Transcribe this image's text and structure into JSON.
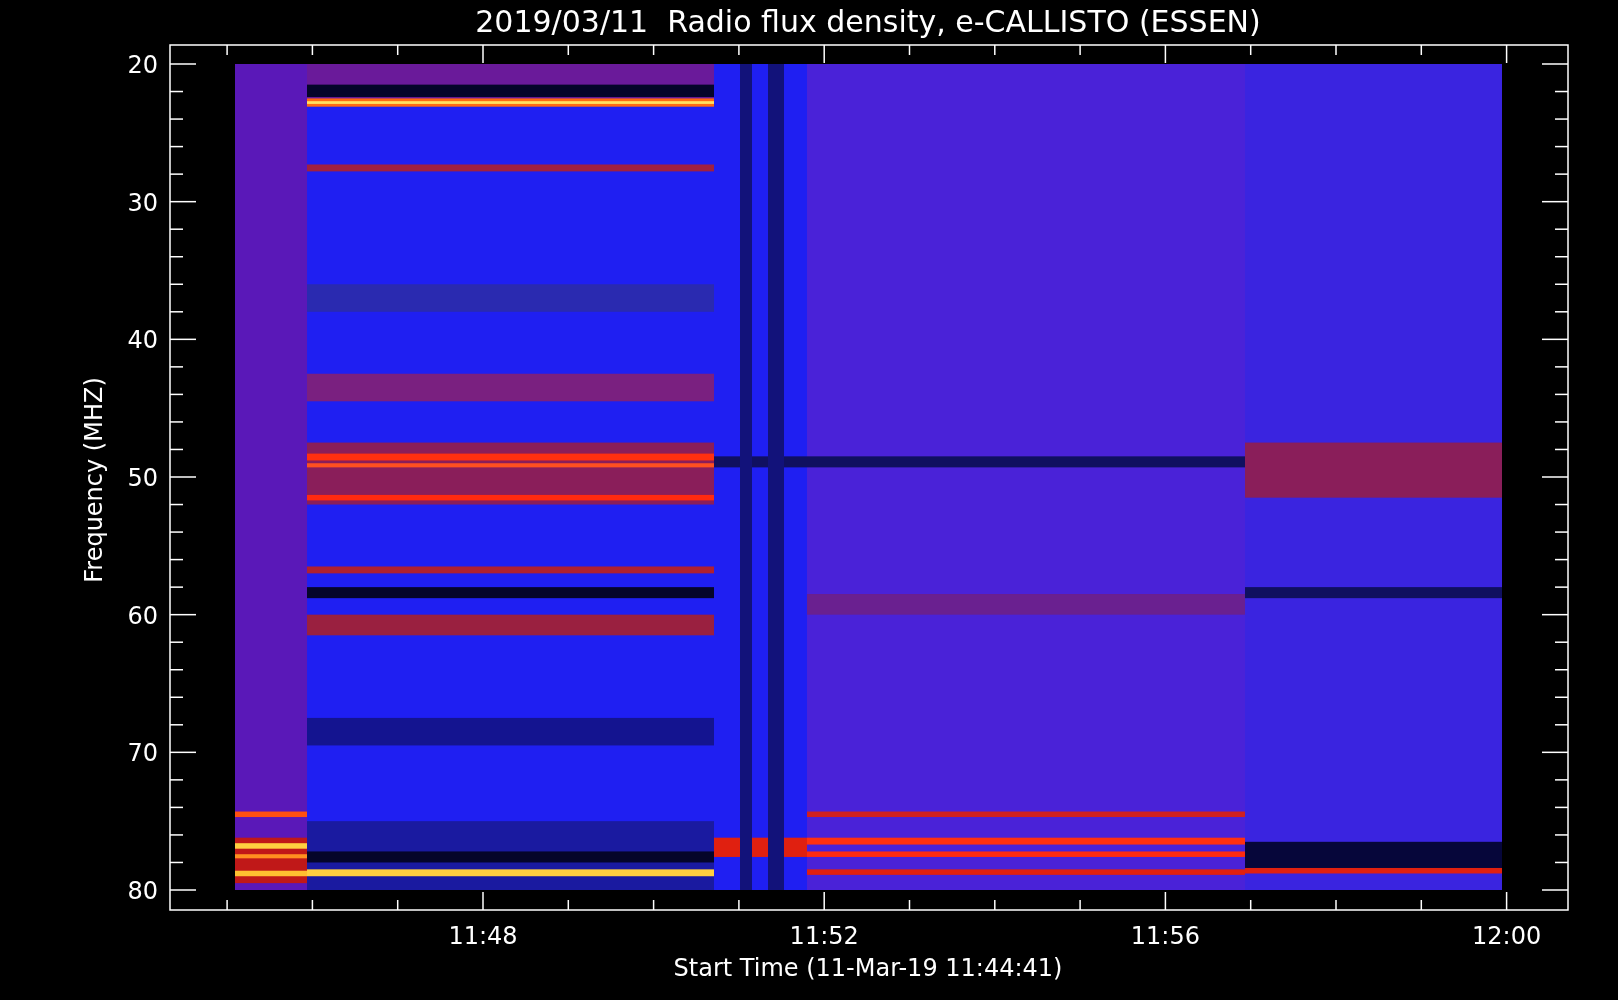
{
  "title": "2019/03/11  Radio flux density, e-CALLISTO (ESSEN)",
  "y_axis": {
    "label": "Frequency (MHZ)",
    "ticks": [
      "20",
      "30",
      "40",
      "50",
      "60",
      "70",
      "80"
    ]
  },
  "x_axis": {
    "label": "Start Time (11-Mar-19 11:44:41)",
    "ticks": [
      "11:48",
      "11:52",
      "11:56",
      "12:00"
    ]
  }
}
